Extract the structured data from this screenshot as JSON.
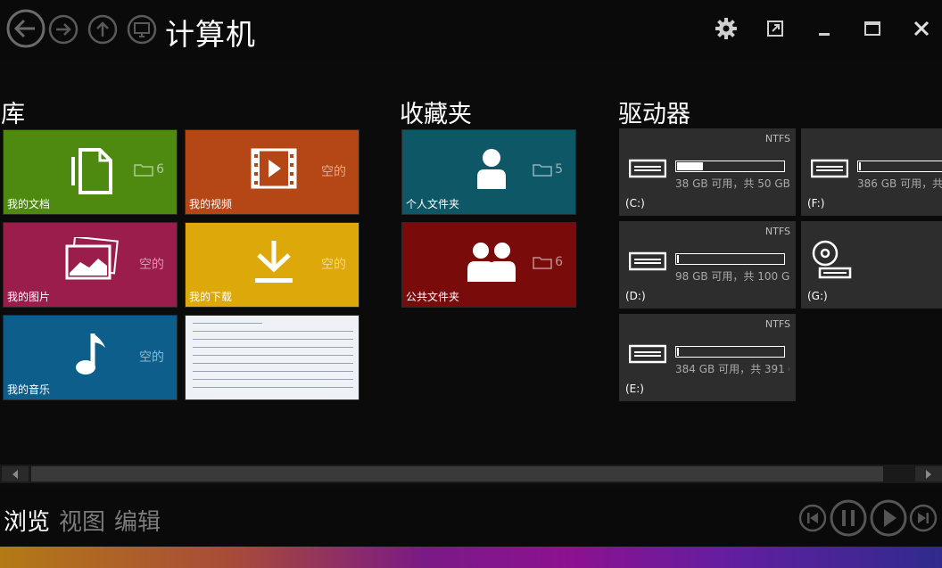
{
  "titlebar": {
    "title": "计算机"
  },
  "sections": {
    "library": "库",
    "favorites": "收藏夹",
    "drives": "驱动器"
  },
  "library_tiles": [
    {
      "label": "我的文档",
      "count": "6",
      "color": "#4f8a10"
    },
    {
      "label": "我的视频",
      "count": "空的",
      "color": "#b54716"
    },
    {
      "label": "我的图片",
      "count": "空的",
      "color": "#9b1d4b"
    },
    {
      "label": "我的下载",
      "count": "空的",
      "color": "#dca80a"
    },
    {
      "label": "我的音乐",
      "count": "空的",
      "color": "#0d5e8a"
    }
  ],
  "favorite_tiles": [
    {
      "label": "个人文件夹",
      "count": "5",
      "color": "#0e5766"
    },
    {
      "label": "公共文件夹",
      "count": "6",
      "color": "#7a0b0b"
    }
  ],
  "drives": [
    {
      "letter": "(C:)",
      "fs": "NTFS",
      "free": "38 GB 可用，共 50 GB",
      "used_fraction": 0.24
    },
    {
      "letter": "(D:)",
      "fs": "NTFS",
      "free": "98 GB 可用，共 100 GI",
      "used_fraction": 0.02
    },
    {
      "letter": "(E:)",
      "fs": "NTFS",
      "free": "384 GB 可用，共 391 (",
      "used_fraction": 0.02
    },
    {
      "letter": "(F:)",
      "fs": "",
      "free": "386 GB 可用，共",
      "used_fraction": 0.02
    },
    {
      "letter": "(G:)",
      "fs": "",
      "free": "",
      "used_fraction": 0
    }
  ],
  "bottom_nav": {
    "browse": "浏览",
    "view": "视图",
    "edit": "编辑"
  },
  "colors": {
    "accent_white": "#ffffff",
    "dim_text": "#7c7c7c"
  }
}
